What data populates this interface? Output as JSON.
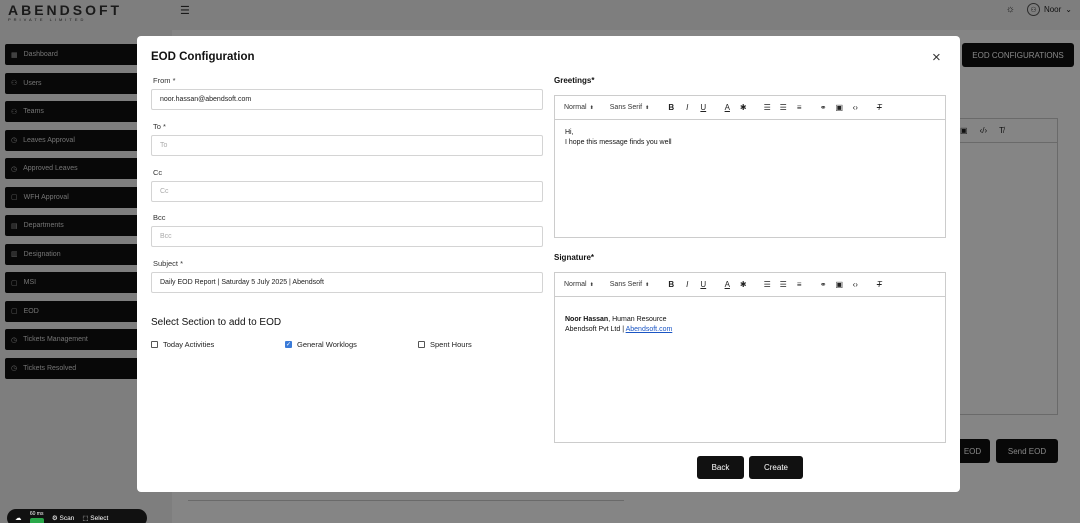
{
  "app": {
    "logo": "ABENDSOFT",
    "logo_sub": "PRIVATE LIMITED",
    "user_name": "Noor",
    "sidebar": [
      {
        "label": "Dashboard",
        "icon": "▦"
      },
      {
        "label": "Users",
        "icon": "⚇"
      },
      {
        "label": "Teams",
        "icon": "⚇"
      },
      {
        "label": "Leaves Approval",
        "icon": "◷"
      },
      {
        "label": "Approved Leaves",
        "icon": "◷"
      },
      {
        "label": "WFH Approval",
        "icon": "▢"
      },
      {
        "label": "Departments",
        "icon": "▤"
      },
      {
        "label": "Designation",
        "icon": "▥"
      },
      {
        "label": "MSI",
        "icon": "▢"
      },
      {
        "label": "EOD",
        "icon": "▢"
      },
      {
        "label": "Tickets Management",
        "icon": "◷"
      },
      {
        "label": "Tickets Resolved",
        "icon": "◷"
      }
    ],
    "eod_configurations_button": "EOD CONFIGURATIONS",
    "eod_button": "EOD",
    "send_eod_button": "Send EOD"
  },
  "devbar": {
    "ms": "60 ms",
    "scan": "Scan",
    "select": "Select"
  },
  "modal": {
    "title": "EOD Configuration",
    "from": {
      "label": "From *",
      "value": "noor.hassan@abendsoft.com"
    },
    "to": {
      "label": "To *",
      "placeholder": "To"
    },
    "cc": {
      "label": "Cc",
      "placeholder": "Cc"
    },
    "bcc": {
      "label": "Bcc",
      "placeholder": "Bcc"
    },
    "subject": {
      "label": "Subject *",
      "value": "Daily EOD Report | Saturday 5 July 2025 | Abendsoft"
    },
    "section_title": "Select Section to add to EOD",
    "sections": [
      {
        "label": "Today Activities",
        "checked": false
      },
      {
        "label": "General Worklogs",
        "checked": true
      },
      {
        "label": "Spent Hours",
        "checked": false
      }
    ],
    "greetings": {
      "label": "Greetings*",
      "format": "Normal",
      "font": "Sans Serif",
      "line1": "Hi,",
      "line2": "I hope this message finds you well"
    },
    "signature": {
      "label": "Signature*",
      "format": "Normal",
      "font": "Sans Serif",
      "name": "Noor Hassan",
      "role": ", Human Resource",
      "company": "Abendsoft Pvt Ltd | ",
      "link": "Abendsoft.com"
    },
    "back_button": "Back",
    "create_button": "Create"
  },
  "colors": {
    "primary_button": "#111111",
    "checkbox_checked": "#3b7bd8",
    "link": "#1a55c4"
  }
}
